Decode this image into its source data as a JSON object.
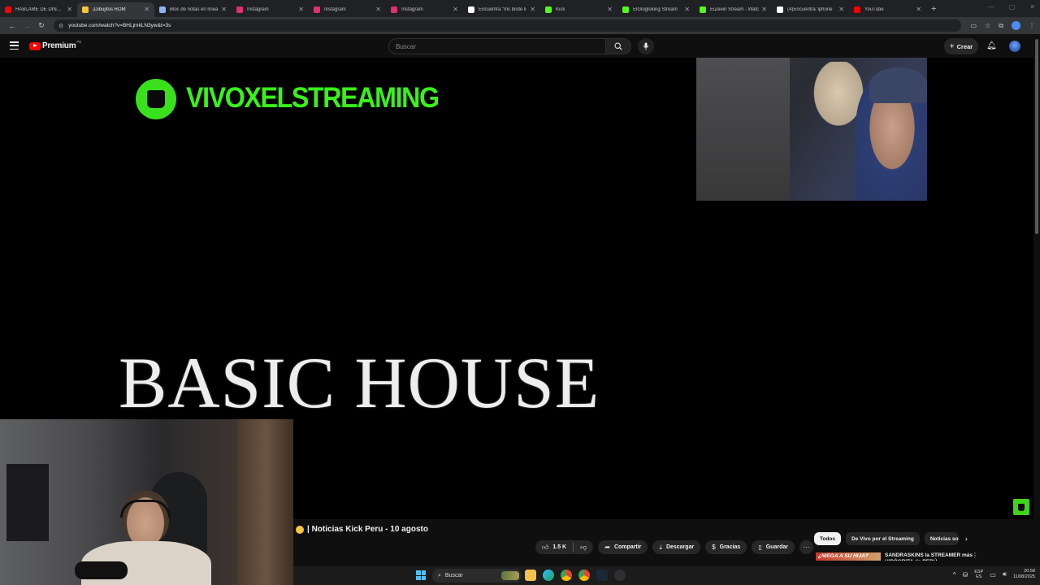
{
  "browser": {
    "tabs": [
      {
        "label": "HÁBLAME DE DINERO",
        "color": "#ff0000"
      },
      {
        "label": "¡Dibujitos ROM",
        "color": "#f4c542",
        "active": true
      },
      {
        "label": "Bloc de notas en línea",
        "color": "#8ab4f8"
      },
      {
        "label": "Instagram",
        "color": "#e1306c"
      },
      {
        "label": "Instagram",
        "color": "#e1306c"
      },
      {
        "label": "Instagram",
        "color": "#e1306c"
      },
      {
        "label": "Encuentra \"mc bride li",
        "color": "#ffffff"
      },
      {
        "label": "Kick",
        "color": "#53fc18"
      },
      {
        "label": "ElGlogloking Stream",
        "color": "#53fc18"
      },
      {
        "label": "ElZeein Stream - Watc",
        "color": "#53fc18"
      },
      {
        "label": "(4)Encuentra 'iphone",
        "color": "#ffffff"
      },
      {
        "label": "YouTube",
        "color": "#ff0000"
      }
    ],
    "new_tab": "+",
    "url": "youtube.com/watch?v=BHLjmkLN3yw&t=3s"
  },
  "youtube": {
    "logo_word": "Premium",
    "country": "PE",
    "search_placeholder": "Buscar",
    "create_label": "Crear"
  },
  "video": {
    "brand_name": "VIVOXELSTREAMING",
    "headline": "BASIC HOUSE",
    "title": "| Noticias Kick Peru - 10 agosto",
    "actions": {
      "like_count": "1.5 K",
      "share": "Compartir",
      "download": "Descargar",
      "thanks": "Gracias",
      "save": "Guardar"
    }
  },
  "chips": [
    "Todos",
    "De Vivo por el Streaming",
    "Noticias sob"
  ],
  "recommendation": {
    "thumb_text": "¿NIEGA A SU HIJA?",
    "title": "SANDRASKINS la STREAMER más HIPÓCRITA de PERÚ"
  },
  "taskbar": {
    "search": "Buscar",
    "lang_line1": "ESP",
    "lang_line2": "ES",
    "time": "20:58",
    "date": "11/08/2025"
  }
}
